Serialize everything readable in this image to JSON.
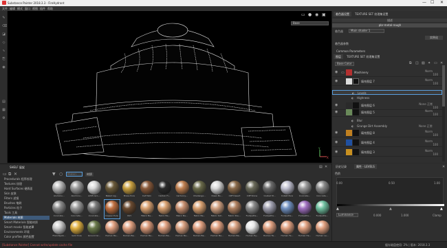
{
  "titlebar": {
    "title": "Substance Painter 2018.3.3 - FireHydrant",
    "min": "—",
    "max": "☐",
    "close": "✕"
  },
  "menubar": {
    "items": [
      "文件",
      "编辑",
      "模式",
      "窗口",
      "视图",
      "插件",
      "帮助"
    ]
  },
  "viewport": {
    "dropdown": "Base",
    "axis_y": "Y",
    "axis_x": "X"
  },
  "right": {
    "tabs": [
      "着色器设置",
      "TEXTURE SET 纹理集设置"
    ],
    "row1": "描述",
    "shader": "pbr-metal-rough",
    "param_label": "着色器",
    "param_value": "Main shader 1",
    "instance_btn": "实例化",
    "section_title": "着色器参数",
    "common_params": "Common Parameters",
    "layer_tabs": [
      "图层",
      "TEXTURE SET 纹理集设置"
    ],
    "base_color": "Base Color",
    "layers": [
      {
        "name": "Mashinery",
        "blend": "Norm",
        "opacity": "100"
      },
      {
        "name": "填充图层 7",
        "blend": "Norm",
        "opacity": "100"
      },
      {
        "name": "Levels",
        "blend": "",
        "opacity": ""
      },
      {
        "name": "Highness",
        "blend": "",
        "opacity": ""
      },
      {
        "name": "填充图层 6",
        "blend": "None 正常",
        "opacity": "100"
      },
      {
        "name": "填充图层 5",
        "blend": "Norm",
        "opacity": "100"
      },
      {
        "name": "Blur",
        "blend": "",
        "opacity": ""
      },
      {
        "name": "Grunge Dirt Assembly",
        "blend": "None 正常",
        "opacity": "100"
      },
      {
        "name": "填充图层 8",
        "blend": "Norm",
        "opacity": "100"
      },
      {
        "name": "填充图层 4",
        "blend": "Norm",
        "opacity": "100"
      },
      {
        "name": "填充图层 3",
        "blend": "Norm",
        "opacity": "100"
      }
    ]
  },
  "shelf": {
    "title": "SHELF 展架",
    "search_placeholder": "Materi",
    "filter_tag": "材质",
    "categories": [
      "Procedurals 程序纹理",
      "Textures 纹理",
      "Hard Surfaces 硬表面",
      "Skin 皮肤",
      "Filters 滤镜",
      "Brushes 笔刷",
      "Particles 粒子",
      "Tools 工具",
      "Materials 材质",
      "Smart Materials 智能材质",
      "Smart masks 智能遮罩",
      "Environments 环境",
      "Color profiles 颜色配置"
    ],
    "active_category": 8,
    "materials_row1": [
      "Aluminiu...",
      "Aluminiu...",
      "Artificial L...",
      "Baked Lig...",
      "Brass Pure",
      "Calf Skin",
      "Carbon Fi...",
      "Cartoony...",
      "Challenge...",
      "Clean Bo...",
      "Cliff Desert",
      "Cliff Stone",
      "Coated M...",
      "Cobalt Pure",
      "Concrete...",
      "Concrete..."
    ],
    "materials_row2": [
      "Concrete...",
      "Concrete...",
      "Concrete...",
      "Copper Pure",
      "Dirt",
      "Fabric Ba...",
      "Fabric Ba...",
      "Fabric Ba...",
      "Fabric Ba...",
      "Fabric Sof...",
      "Fabric Rou...",
      "Footpaths...",
      "Footpaths...",
      "Footpaths...",
      "Footpaths...",
      "Footpaths..."
    ],
    "materials_row3": [
      "Friendlywb...",
      "Gold Pure",
      "Ground Gr...",
      "Human Ba...",
      "Human Ba...",
      "Human Ba...",
      "Human Ba...",
      "Human Ba...",
      "Human Ba...",
      "Human Ba...",
      "Human Ba...",
      "Human Ey...",
      "Human Fe...",
      "Human Fe...",
      "Human He...",
      "Human Le..."
    ],
    "selected_material": "Copper Pure"
  },
  "curve": {
    "tabs": [
      "历史记录",
      "属性 - LEVELS",
      "显示设置"
    ],
    "label": "色阶",
    "min": "0.00",
    "mid": "0.50",
    "max": "1.00",
    "mode_label": "Luminance",
    "out_low": "0.000",
    "out_high": "1.000",
    "clamp": "Clamp"
  },
  "status": {
    "left": "[Substance Painter] Cannot write/update cache file",
    "right": "缓存磁盘使用: 2%  | 版本: 2018.3.3"
  },
  "colors": {
    "accent": "#5aa0e0",
    "selected_cat": "#3e5a7a"
  }
}
